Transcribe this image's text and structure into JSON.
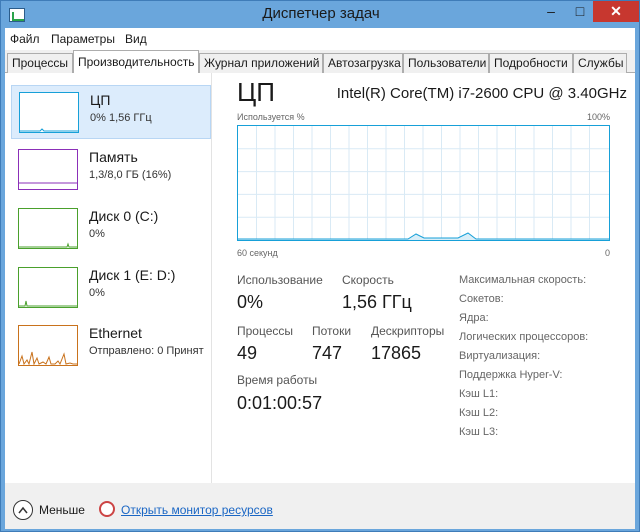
{
  "window": {
    "title": "Диспетчер задач",
    "controls": {
      "minimize": "–",
      "maximize": "□",
      "close": "✕"
    }
  },
  "menu": [
    "Файл",
    "Параметры",
    "Вид"
  ],
  "tabs": [
    "Процессы",
    "Производительность",
    "Журнал приложений",
    "Автозагрузка",
    "Пользователи",
    "Подробности",
    "Службы"
  ],
  "active_tab": "Производительность",
  "sidebar": {
    "items": [
      {
        "title": "ЦП",
        "sub": "0%  1,56 ГГц",
        "color": "#17a0d8"
      },
      {
        "title": "Память",
        "sub": "1,3/8,0 ГБ (16%)",
        "color": "#8b2fb8"
      },
      {
        "title": "Диск 0 (C:)",
        "sub": "0%",
        "color": "#4aa02c"
      },
      {
        "title": "Диск 1 (E: D:)",
        "sub": "0%",
        "color": "#4aa02c"
      },
      {
        "title": "Ethernet",
        "sub": "Отправлено: 0 Принят",
        "color": "#c9721c"
      }
    ]
  },
  "main": {
    "title": "ЦП",
    "cpu_name": "Intel(R) Core(TM) i7-2600 CPU @ 3.40GHz",
    "graph": {
      "label_top_left": "Используется %",
      "label_top_right": "100%",
      "label_bottom_left": "60 секунд",
      "label_bottom_right": "0"
    },
    "stats": {
      "utilization_label": "Использование",
      "utilization_value": "0%",
      "speed_label": "Скорость",
      "speed_value": "1,56 ГГц",
      "processes_label": "Процессы",
      "processes_value": "49",
      "threads_label": "Потоки",
      "threads_value": "747",
      "handles_label": "Дескрипторы",
      "handles_value": "17865",
      "uptime_label": "Время работы",
      "uptime_value": "0:01:00:57"
    },
    "properties": [
      "Максимальная скорость:",
      "Сокетов:",
      "Ядра:",
      "Логических процессоров:",
      "Виртуализация:",
      "Поддержка Hyper-V:",
      "Кэш L1:",
      "Кэш L2:",
      "Кэш L3:"
    ]
  },
  "footer": {
    "less_label": "Меньше",
    "resource_monitor_link": "Открыть монитор ресурсов"
  },
  "colors": {
    "title_bar": "#6aa6dc",
    "cpu_accent": "#17a0d8",
    "close_button": "#c7372f",
    "link": "#1a66c4"
  }
}
